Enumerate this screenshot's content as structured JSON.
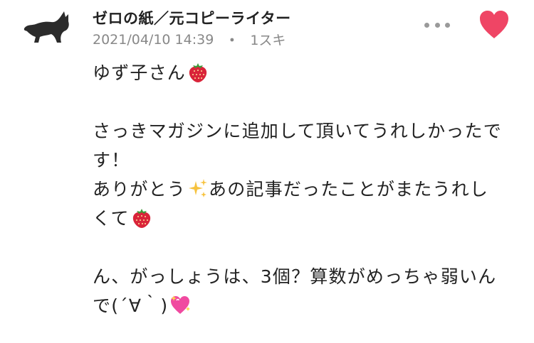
{
  "comment": {
    "author_name": "ゼロの紙／元コピーライター",
    "timestamp": "2021/04/10 14:39",
    "meta_separator": "・",
    "likes_label": "1スキ",
    "colors": {
      "heart": "#ef4565",
      "meta_text": "#888888",
      "body_text": "#222222",
      "dots": "#9a9a9a"
    },
    "body": {
      "greeting": "ゆず子さん",
      "line1": "さっきマガジンに追加して頂いてうれしかったで",
      "line2": "す！",
      "line3": "ありがとう",
      "line3b": "あの記事だったことがまたうれし",
      "line4": "くて",
      "line5": "ん、がっしょうは、3個？算数がめっちゃ弱いん",
      "line6": "で(´∀｀)"
    },
    "icons": {
      "avatar": "black-cat-icon",
      "more": "more-dots-icon",
      "like": "heart-icon",
      "emoji_strawberry": "strawberry-emoji",
      "emoji_sparkles": "sparkles-emoji",
      "emoji_sparkling_heart": "sparkling-heart-emoji"
    }
  }
}
